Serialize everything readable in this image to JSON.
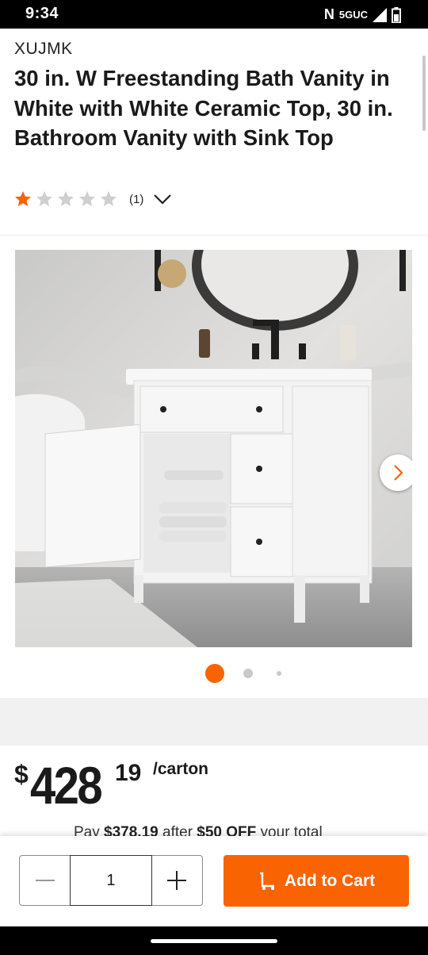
{
  "status": {
    "time": "9:34",
    "nfc": "N",
    "network": "5GUC"
  },
  "product": {
    "brand": "XUJMK",
    "title": "30 in. W Freestanding Bath Vanity in White with White Ceramic Top, 30 in. Bathroom Vanity with Sink Top",
    "rating": 1,
    "rating_max": 5,
    "review_count": "(1)"
  },
  "gallery": {
    "image_count": 3,
    "active_index": 0
  },
  "price": {
    "symbol": "$",
    "dollars": "428",
    "cents": "19",
    "unit": "/carton",
    "promo_prefix": "Pay ",
    "promo_amount": "$378.19",
    "promo_mid": " after ",
    "promo_discount": "$50 OFF",
    "promo_suffix": " your total"
  },
  "cart": {
    "quantity": "1",
    "add_label": "Add to Cart"
  },
  "colors": {
    "accent": "#f96302",
    "star_filled": "#f96302",
    "star_empty": "#cfcfcf"
  }
}
